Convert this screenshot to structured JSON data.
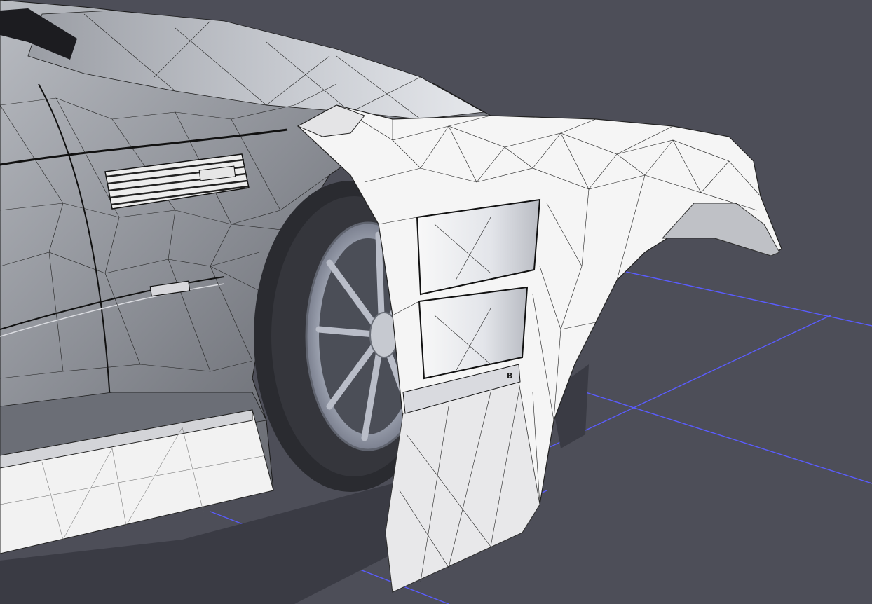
{
  "viewport": {
    "background_color": "#4d4e58",
    "grid_color": "#5a5cff",
    "body_color": "#8e9199",
    "panel_color": "#f4f4f4",
    "wireframe_color": "#1a1a1a"
  },
  "scene": {
    "objects": [
      {
        "name": "car-body",
        "shading": "wireframe-on-shaded"
      },
      {
        "name": "front-wheel",
        "shading": "shaded"
      },
      {
        "name": "wide-fender-bodykit",
        "shading": "wireframe-on-shaded"
      },
      {
        "name": "side-skirt",
        "shading": "wireframe-on-shaded"
      }
    ],
    "marker_label": "B"
  }
}
